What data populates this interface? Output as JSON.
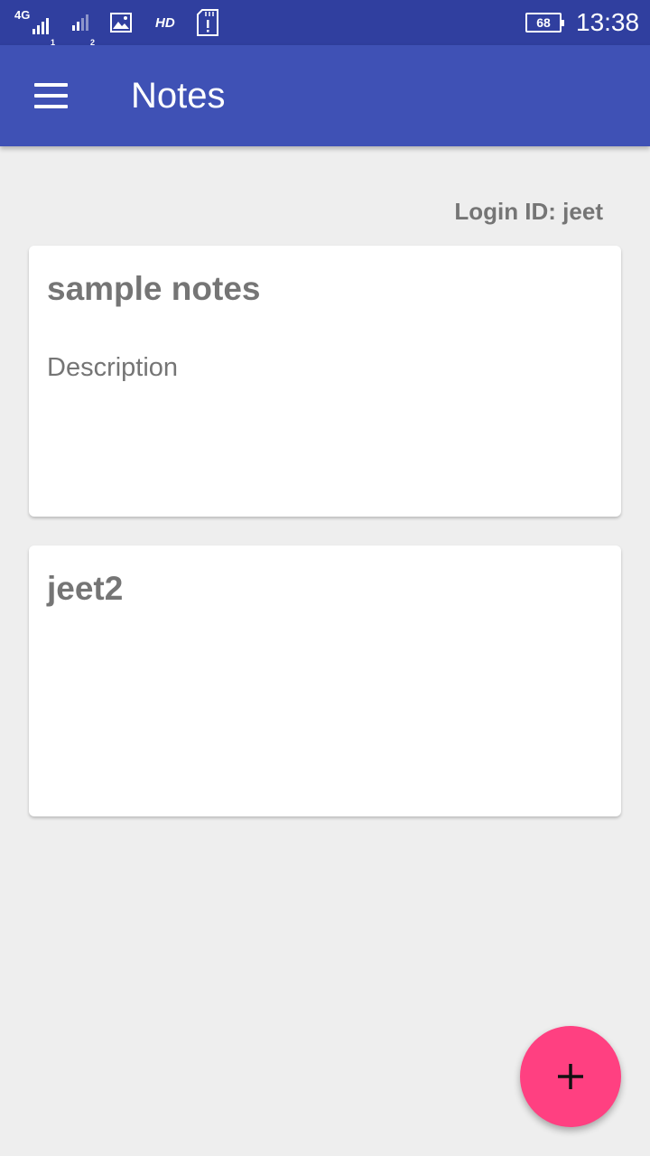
{
  "status_bar": {
    "network_type": "4G",
    "battery_level": "68",
    "time": "13:38",
    "hd_label": "HD",
    "icons": [
      "signal-sim1-icon",
      "signal-sim2-icon",
      "gallery-icon",
      "sd-card-icon",
      "battery-icon"
    ]
  },
  "toolbar": {
    "title": "Notes",
    "menu_icon": "hamburger-menu-icon",
    "background_color": "#3f51b5",
    "status_color": "#303f9f"
  },
  "login": {
    "label": "Login ID: jeet"
  },
  "notes": [
    {
      "title": "sample notes",
      "description": "Description"
    },
    {
      "title": "jeet2",
      "description": ""
    }
  ],
  "fab": {
    "icon": "add-icon",
    "color": "#ff4081"
  }
}
